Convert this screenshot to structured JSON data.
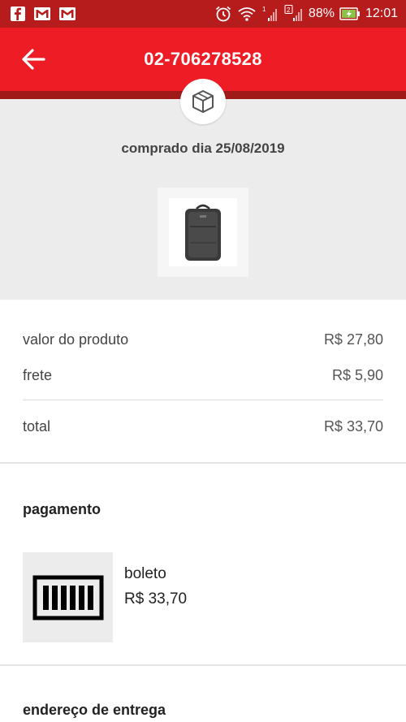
{
  "status_bar": {
    "battery": "88%",
    "time": "12:01"
  },
  "app_bar": {
    "title": "02-706278528"
  },
  "order": {
    "purchase_date": "comprado dia 25/08/2019"
  },
  "summary": {
    "product_label": "valor do produto",
    "product_value": "R$ 27,80",
    "shipping_label": "frete",
    "shipping_value": "R$ 5,90",
    "total_label": "total",
    "total_value": "R$ 33,70"
  },
  "payment": {
    "title": "pagamento",
    "method": "boleto",
    "amount": "R$ 33,70"
  },
  "address": {
    "title": "endereço de entrega"
  },
  "colors": {
    "status_bar": "#b71c1c",
    "app_bar": "#ee1c24"
  }
}
